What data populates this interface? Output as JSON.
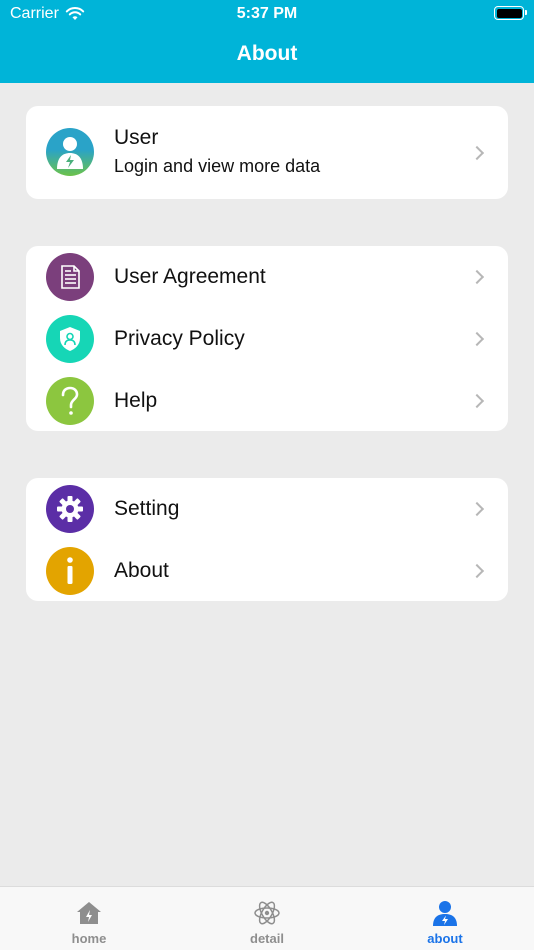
{
  "status_bar": {
    "carrier": "Carrier",
    "time": "5:37 PM"
  },
  "header": {
    "title": "About"
  },
  "user_card": {
    "name": "User",
    "subtitle": "Login and view more data",
    "icon": "user-avatar-icon"
  },
  "info_menu": [
    {
      "label": "User Agreement",
      "icon": "document-icon",
      "color": "#7b3f7c"
    },
    {
      "label": "Privacy Policy",
      "icon": "shield-user-icon",
      "color": "#16d6b6"
    },
    {
      "label": "Help",
      "icon": "question-icon",
      "color": "#8cc63f"
    }
  ],
  "settings_menu": [
    {
      "label": "Setting",
      "icon": "gear-icon",
      "color": "#5b2ea6"
    },
    {
      "label": "About",
      "icon": "info-icon",
      "color": "#e3a400"
    }
  ],
  "tab_bar": {
    "tabs": [
      {
        "label": "home",
        "icon": "home-icon",
        "active": false
      },
      {
        "label": "detail",
        "icon": "atom-icon",
        "active": false
      },
      {
        "label": "about",
        "icon": "person-icon",
        "active": true
      }
    ]
  },
  "colors": {
    "accent": "#00b4d8",
    "tab_active": "#1a73e8",
    "background": "#ebebeb"
  }
}
